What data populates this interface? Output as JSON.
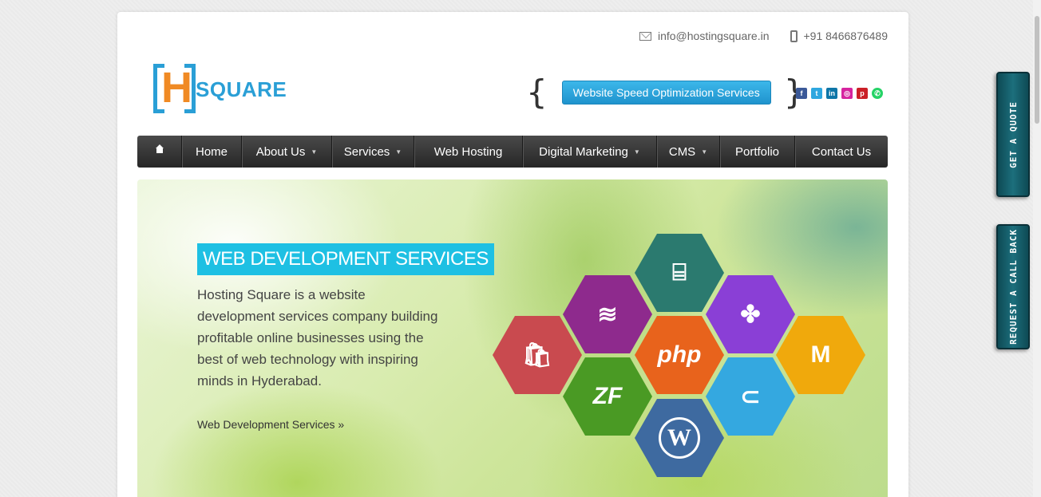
{
  "contact": {
    "email": "info@hostingsquare.in",
    "phone": "+91 8466876489"
  },
  "logo": {
    "letter": "H",
    "word": "SQUARE"
  },
  "promo": {
    "open_brace": "{",
    "close_brace": "}",
    "button_label": "Website Speed Optimization Services"
  },
  "social": [
    {
      "icon": "facebook-icon",
      "glyph": "f"
    },
    {
      "icon": "twitter-icon",
      "glyph": "t"
    },
    {
      "icon": "linkedin-icon",
      "glyph": "in"
    },
    {
      "icon": "instagram-icon",
      "glyph": "◎"
    },
    {
      "icon": "pinterest-icon",
      "glyph": "p"
    },
    {
      "icon": "whatsapp-icon",
      "glyph": "✆"
    }
  ],
  "nav": {
    "items": [
      {
        "label": "Home",
        "caret": false
      },
      {
        "label": "About Us",
        "caret": true
      },
      {
        "label": "Services",
        "caret": true
      },
      {
        "label": "Web Hosting",
        "caret": false
      },
      {
        "label": "Digital Marketing",
        "caret": true
      },
      {
        "label": "CMS",
        "caret": true
      },
      {
        "label": "Portfolio",
        "caret": false
      },
      {
        "label": "Contact Us",
        "caret": false
      }
    ]
  },
  "hero": {
    "title": "WEB DEVELOPMENT SERVICES",
    "text": "Hosting Square is a website development services company building profitable online businesses using the best of web technology with inspiring minds in Hyderabad.",
    "link": "Web Development Services »",
    "hexes": [
      {
        "name": "shopping-bag-hex",
        "symbol": "🛍",
        "color": "#c94a4f"
      },
      {
        "name": "opencart-stack-hex",
        "symbol": "≋",
        "color": "#8e2a8d"
      },
      {
        "name": "html-builder-hex",
        "symbol": "⌸",
        "color": "#2b7a6f"
      },
      {
        "name": "php-hex",
        "symbol": "php",
        "color": "#e8631c"
      },
      {
        "name": "zend-hex",
        "symbol": "ZF",
        "color": "#4a9a24"
      },
      {
        "name": "joomla-hex",
        "symbol": "✤",
        "color": "#8a3fd6"
      },
      {
        "name": "wordpress-hex",
        "symbol": "W",
        "color": "#3e6aa0"
      },
      {
        "name": "opencart-cart-hex",
        "symbol": "⊂",
        "color": "#34a8e0"
      },
      {
        "name": "magento-hex",
        "symbol": "M",
        "color": "#f0a90c"
      }
    ]
  },
  "side_tabs": {
    "quote": "GET A QUOTE",
    "callback": "REQUEST A CALL BACK"
  }
}
